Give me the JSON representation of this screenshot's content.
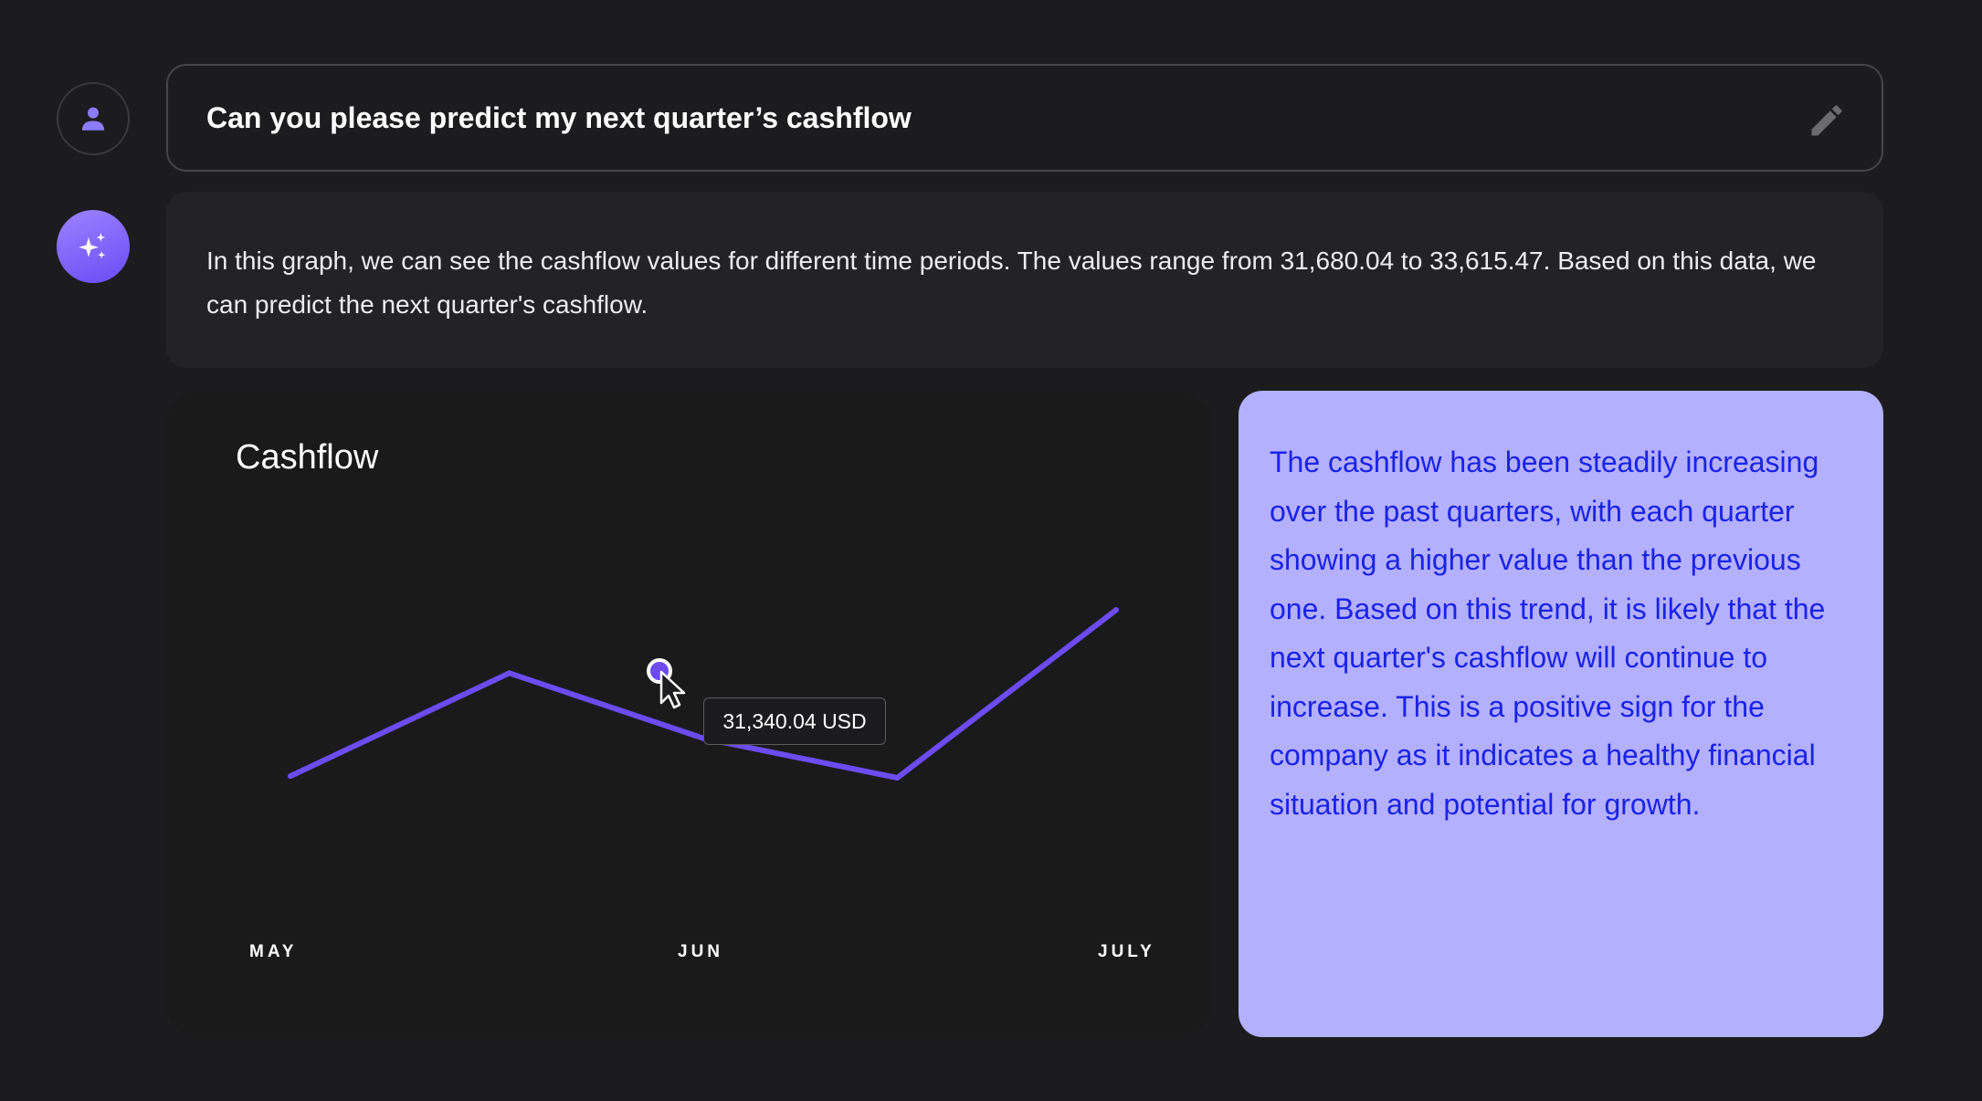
{
  "prompt": {
    "text": "Can you please predict my next quarter’s cashflow",
    "edit_icon": "pencil-icon"
  },
  "icons": {
    "user_avatar": "person-icon",
    "ai_avatar": "sparkles-icon"
  },
  "answer": {
    "text": "In this graph, we can see the cashflow values for different time periods. The values range from 31,680.04 to 33,615.47. Based on this data, we can predict the next quarter's cashflow."
  },
  "chart_data": {
    "type": "line",
    "title": "Cashflow",
    "categories": [
      "MAY",
      "JUN",
      "JULY"
    ],
    "x": [
      0,
      0.53,
      1,
      1.47,
      2
    ],
    "values": [
      31680.04,
      32880,
      32120,
      31660,
      33615.47
    ],
    "ylim": [
      30000,
      35000
    ],
    "tooltip": "31,340.04 USD",
    "grid": false,
    "line_color": "#6c4cf1"
  },
  "insight": {
    "text": "The cashflow has been steadily increasing over the past quarters, with each quarter showing a higher value than the previous one. Based on this trend, it is likely that the next quarter's cashflow will continue to increase. This is a positive sign for the company as it indicates a healthy financial situation and potential for growth."
  },
  "colors": {
    "background": "#1c1c1e",
    "accent": "#6c4cf1",
    "insight_bg": "#b3b0ff",
    "insight_text": "#1b22e6"
  }
}
